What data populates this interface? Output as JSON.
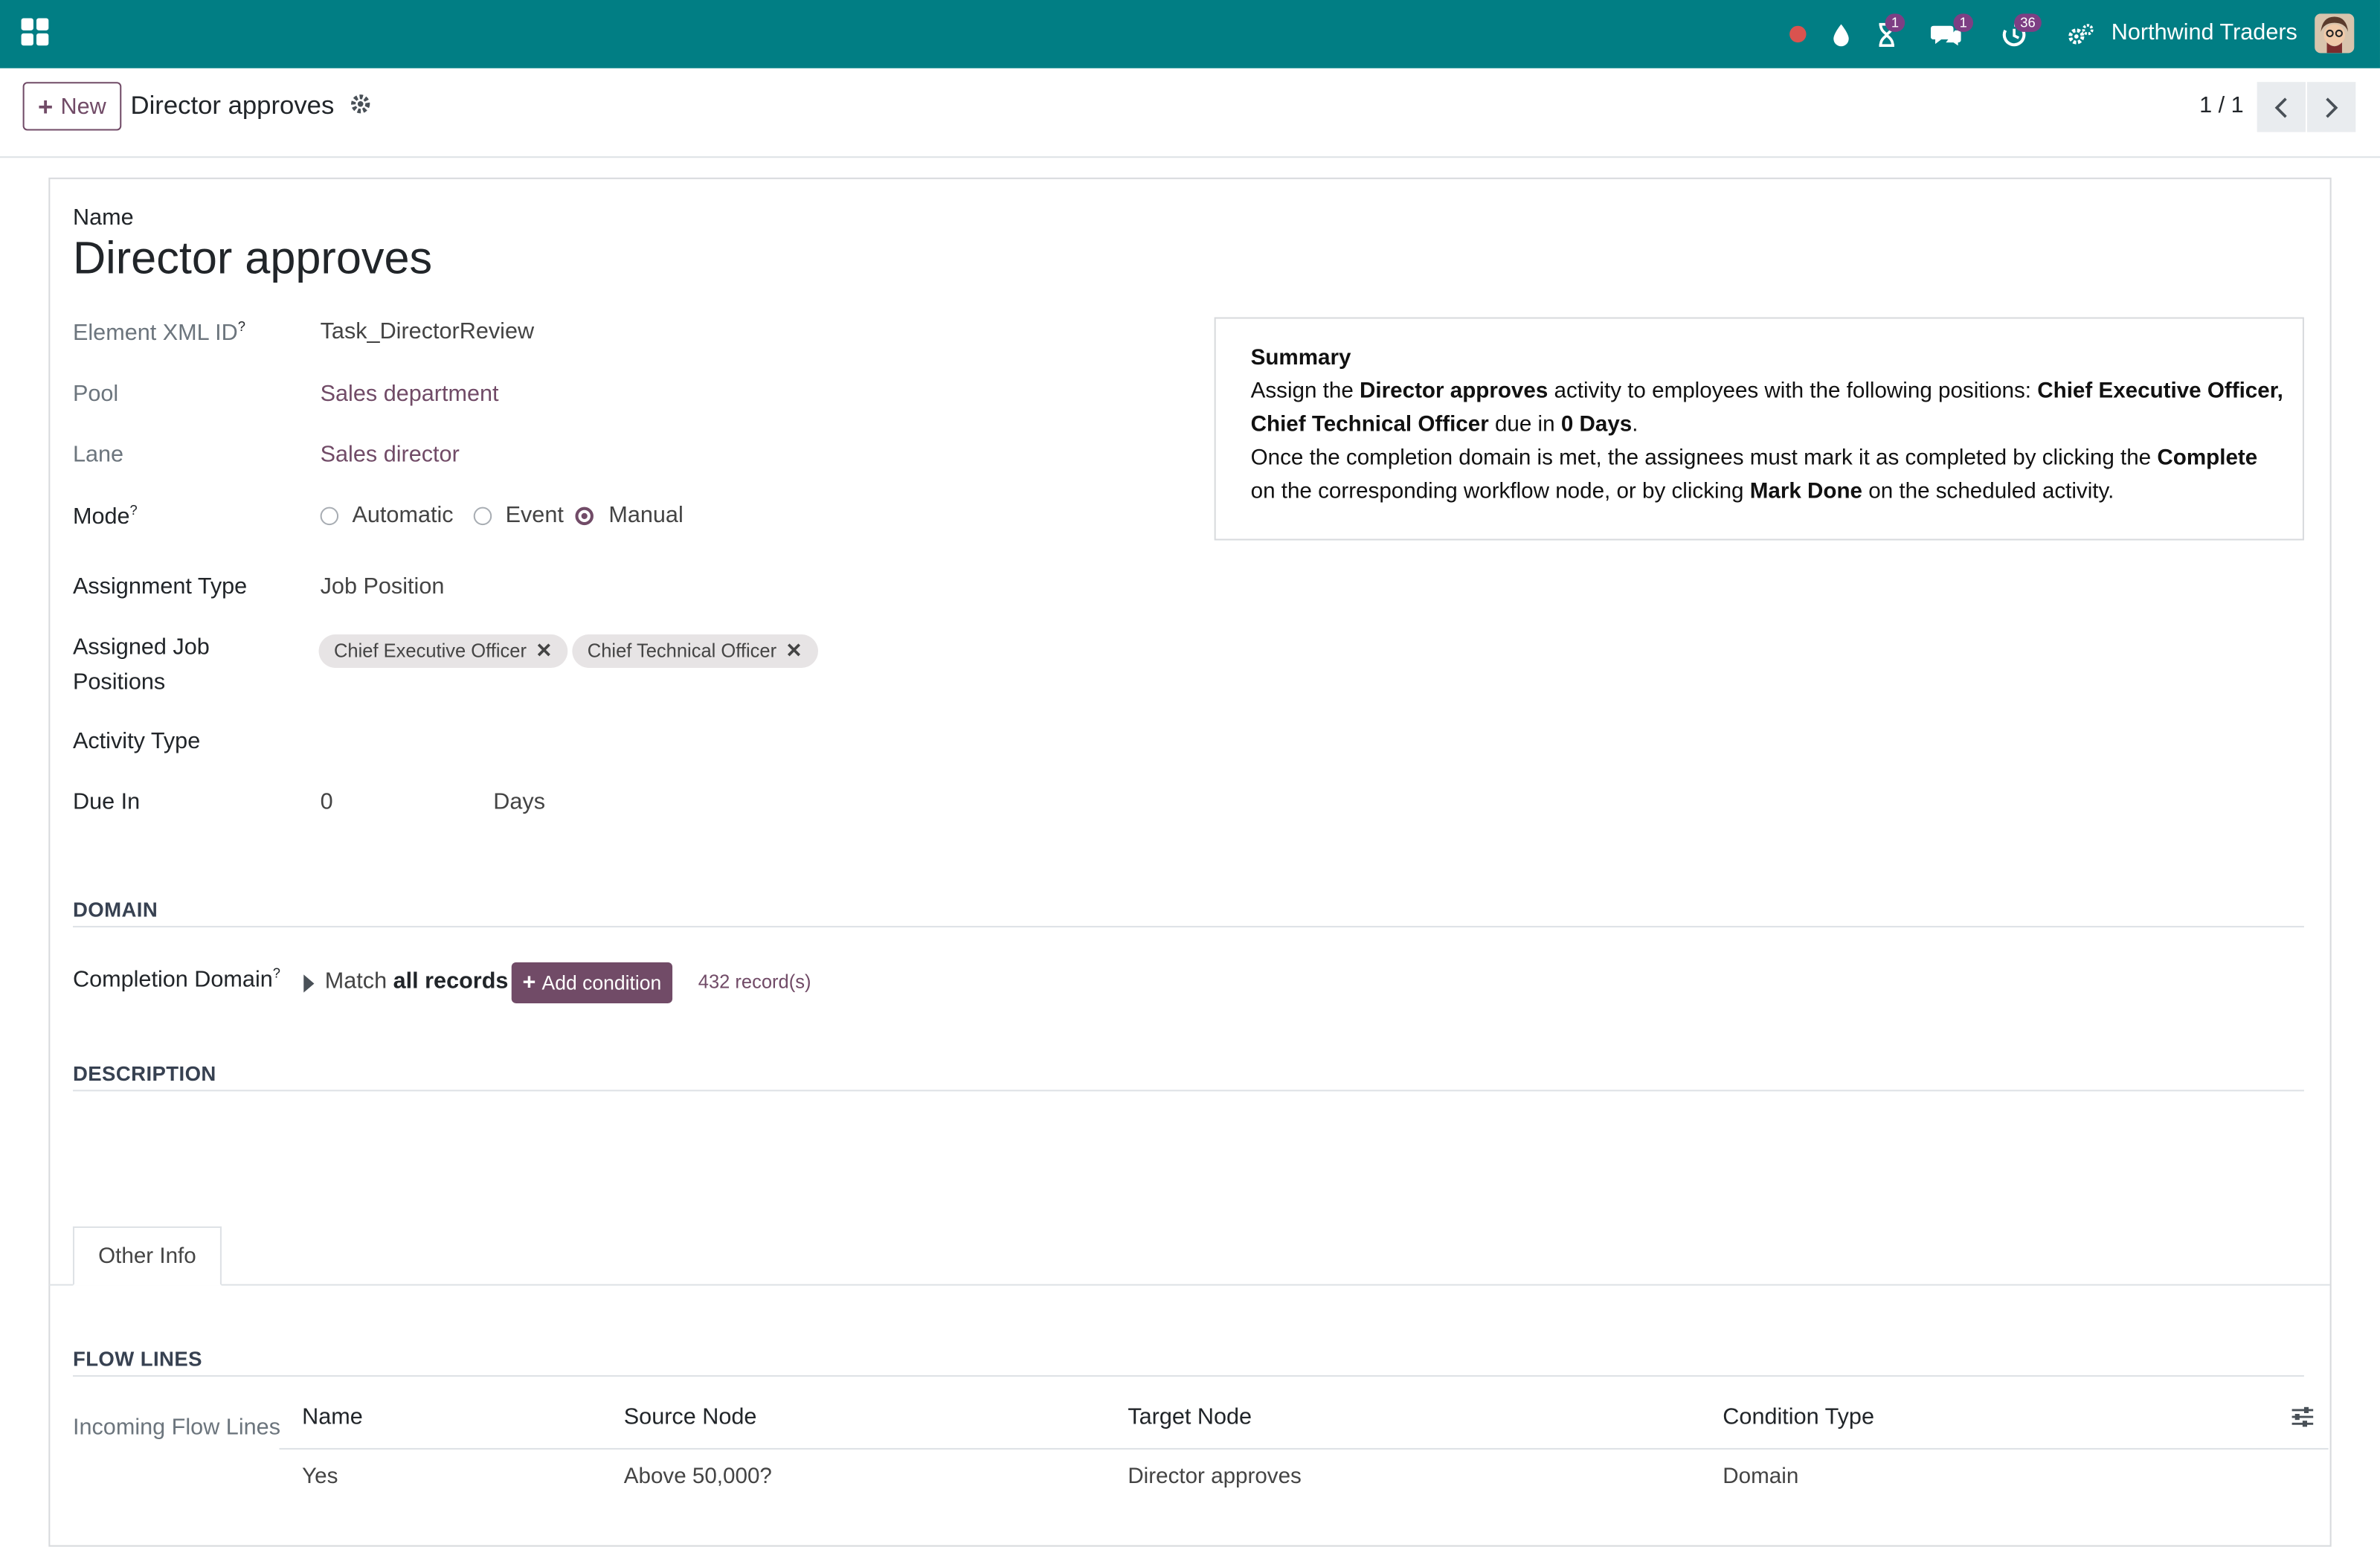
{
  "topbar": {
    "company": "Northwind Traders",
    "badges": {
      "activities": "1",
      "messages": "1",
      "clock": "36"
    }
  },
  "control_panel": {
    "new_label": "New",
    "breadcrumb": "Director approves",
    "pager": "1 / 1"
  },
  "form": {
    "name_label": "Name",
    "name_value": "Director approves",
    "xml_id_label": "Element XML ID",
    "xml_id_value": "Task_DirectorReview",
    "pool_label": "Pool",
    "pool_value": "Sales department",
    "lane_label": "Lane",
    "lane_value": "Sales director",
    "mode_label": "Mode",
    "mode_options": [
      "Automatic",
      "Event",
      "Manual"
    ],
    "mode_selected": "Manual",
    "assignment_type_label": "Assignment Type",
    "assignment_type_value": "Job Position",
    "assigned_positions_label_1": "Assigned Job",
    "assigned_positions_label_2": "Positions",
    "assigned_positions": [
      "Chief Executive Officer",
      "Chief Technical Officer"
    ],
    "activity_type_label": "Activity Type",
    "due_in_label": "Due In",
    "due_in_value": "0",
    "due_in_unit": "Days",
    "help_mark": "?"
  },
  "summary": {
    "title": "Summary",
    "line1": {
      "a": "Assign the ",
      "b": "Director approves",
      "c": " activity to employees with the following positions: ",
      "d": "Chief Executive Officer,"
    },
    "line2": {
      "a": "Chief Technical Officer",
      "b": " due in ",
      "c": "0 Days",
      "d": "."
    },
    "line3": {
      "a": "Once the completion domain is met, the assignees must mark it as completed by clicking the ",
      "b": "Complete"
    },
    "line4": {
      "a": "on the corresponding workflow node, or by clicking ",
      "b": "Mark Done",
      "c": " on the scheduled activity."
    }
  },
  "domain_section": {
    "title": "DOMAIN",
    "completion_label": "Completion Domain",
    "match_text": "Match ",
    "match_bold": "all records",
    "add_condition": "Add condition",
    "record_count": "432 record(s)"
  },
  "description_section": {
    "title": "DESCRIPTION"
  },
  "tabs": {
    "other_info": "Other Info"
  },
  "flow_lines": {
    "title": "FLOW LINES",
    "incoming_label": "Incoming Flow Lines",
    "columns": [
      "Name",
      "Source Node",
      "Target Node",
      "Condition Type"
    ],
    "rows": [
      [
        "Yes",
        "Above 50,000?",
        "Director approves",
        "Domain"
      ]
    ]
  }
}
